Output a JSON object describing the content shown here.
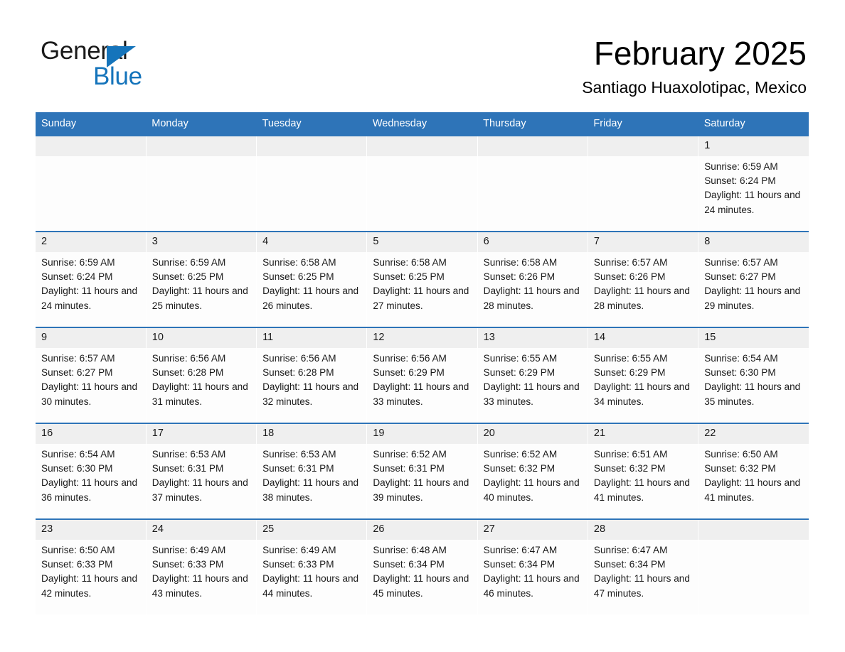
{
  "logo": {
    "line1": "General",
    "line2": "Blue",
    "triangle_color": "#1574bb"
  },
  "header": {
    "title": "February 2025",
    "subtitle": "Santiago Huaxolotipac, Mexico"
  },
  "colors": {
    "header_blue": "#2e74b8",
    "daynum_band": "#efefef",
    "cell_background": "#fdfdfd",
    "text": "#1a1a1a"
  },
  "labels": {
    "sunrise_prefix": "Sunrise:",
    "sunset_prefix": "Sunset:",
    "daylight_prefix": "Daylight:"
  },
  "weekdays": [
    "Sunday",
    "Monday",
    "Tuesday",
    "Wednesday",
    "Thursday",
    "Friday",
    "Saturday"
  ],
  "weeks": [
    [
      {
        "day": "",
        "lines": []
      },
      {
        "day": "",
        "lines": []
      },
      {
        "day": "",
        "lines": []
      },
      {
        "day": "",
        "lines": []
      },
      {
        "day": "",
        "lines": []
      },
      {
        "day": "",
        "lines": []
      },
      {
        "day": "1",
        "lines": [
          "Sunrise: 6:59 AM",
          "Sunset: 6:24 PM",
          "Daylight: 11 hours and 24 minutes."
        ]
      }
    ],
    [
      {
        "day": "2",
        "lines": [
          "Sunrise: 6:59 AM",
          "Sunset: 6:24 PM",
          "Daylight: 11 hours and 24 minutes."
        ]
      },
      {
        "day": "3",
        "lines": [
          "Sunrise: 6:59 AM",
          "Sunset: 6:25 PM",
          "Daylight: 11 hours and 25 minutes."
        ]
      },
      {
        "day": "4",
        "lines": [
          "Sunrise: 6:58 AM",
          "Sunset: 6:25 PM",
          "Daylight: 11 hours and 26 minutes."
        ]
      },
      {
        "day": "5",
        "lines": [
          "Sunrise: 6:58 AM",
          "Sunset: 6:25 PM",
          "Daylight: 11 hours and 27 minutes."
        ]
      },
      {
        "day": "6",
        "lines": [
          "Sunrise: 6:58 AM",
          "Sunset: 6:26 PM",
          "Daylight: 11 hours and 28 minutes."
        ]
      },
      {
        "day": "7",
        "lines": [
          "Sunrise: 6:57 AM",
          "Sunset: 6:26 PM",
          "Daylight: 11 hours and 28 minutes."
        ]
      },
      {
        "day": "8",
        "lines": [
          "Sunrise: 6:57 AM",
          "Sunset: 6:27 PM",
          "Daylight: 11 hours and 29 minutes."
        ]
      }
    ],
    [
      {
        "day": "9",
        "lines": [
          "Sunrise: 6:57 AM",
          "Sunset: 6:27 PM",
          "Daylight: 11 hours and 30 minutes."
        ]
      },
      {
        "day": "10",
        "lines": [
          "Sunrise: 6:56 AM",
          "Sunset: 6:28 PM",
          "Daylight: 11 hours and 31 minutes."
        ]
      },
      {
        "day": "11",
        "lines": [
          "Sunrise: 6:56 AM",
          "Sunset: 6:28 PM",
          "Daylight: 11 hours and 32 minutes."
        ]
      },
      {
        "day": "12",
        "lines": [
          "Sunrise: 6:56 AM",
          "Sunset: 6:29 PM",
          "Daylight: 11 hours and 33 minutes."
        ]
      },
      {
        "day": "13",
        "lines": [
          "Sunrise: 6:55 AM",
          "Sunset: 6:29 PM",
          "Daylight: 11 hours and 33 minutes."
        ]
      },
      {
        "day": "14",
        "lines": [
          "Sunrise: 6:55 AM",
          "Sunset: 6:29 PM",
          "Daylight: 11 hours and 34 minutes."
        ]
      },
      {
        "day": "15",
        "lines": [
          "Sunrise: 6:54 AM",
          "Sunset: 6:30 PM",
          "Daylight: 11 hours and 35 minutes."
        ]
      }
    ],
    [
      {
        "day": "16",
        "lines": [
          "Sunrise: 6:54 AM",
          "Sunset: 6:30 PM",
          "Daylight: 11 hours and 36 minutes."
        ]
      },
      {
        "day": "17",
        "lines": [
          "Sunrise: 6:53 AM",
          "Sunset: 6:31 PM",
          "Daylight: 11 hours and 37 minutes."
        ]
      },
      {
        "day": "18",
        "lines": [
          "Sunrise: 6:53 AM",
          "Sunset: 6:31 PM",
          "Daylight: 11 hours and 38 minutes."
        ]
      },
      {
        "day": "19",
        "lines": [
          "Sunrise: 6:52 AM",
          "Sunset: 6:31 PM",
          "Daylight: 11 hours and 39 minutes."
        ]
      },
      {
        "day": "20",
        "lines": [
          "Sunrise: 6:52 AM",
          "Sunset: 6:32 PM",
          "Daylight: 11 hours and 40 minutes."
        ]
      },
      {
        "day": "21",
        "lines": [
          "Sunrise: 6:51 AM",
          "Sunset: 6:32 PM",
          "Daylight: 11 hours and 41 minutes."
        ]
      },
      {
        "day": "22",
        "lines": [
          "Sunrise: 6:50 AM",
          "Sunset: 6:32 PM",
          "Daylight: 11 hours and 41 minutes."
        ]
      }
    ],
    [
      {
        "day": "23",
        "lines": [
          "Sunrise: 6:50 AM",
          "Sunset: 6:33 PM",
          "Daylight: 11 hours and 42 minutes."
        ]
      },
      {
        "day": "24",
        "lines": [
          "Sunrise: 6:49 AM",
          "Sunset: 6:33 PM",
          "Daylight: 11 hours and 43 minutes."
        ]
      },
      {
        "day": "25",
        "lines": [
          "Sunrise: 6:49 AM",
          "Sunset: 6:33 PM",
          "Daylight: 11 hours and 44 minutes."
        ]
      },
      {
        "day": "26",
        "lines": [
          "Sunrise: 6:48 AM",
          "Sunset: 6:34 PM",
          "Daylight: 11 hours and 45 minutes."
        ]
      },
      {
        "day": "27",
        "lines": [
          "Sunrise: 6:47 AM",
          "Sunset: 6:34 PM",
          "Daylight: 11 hours and 46 minutes."
        ]
      },
      {
        "day": "28",
        "lines": [
          "Sunrise: 6:47 AM",
          "Sunset: 6:34 PM",
          "Daylight: 11 hours and 47 minutes."
        ]
      },
      {
        "day": "",
        "lines": []
      }
    ]
  ]
}
